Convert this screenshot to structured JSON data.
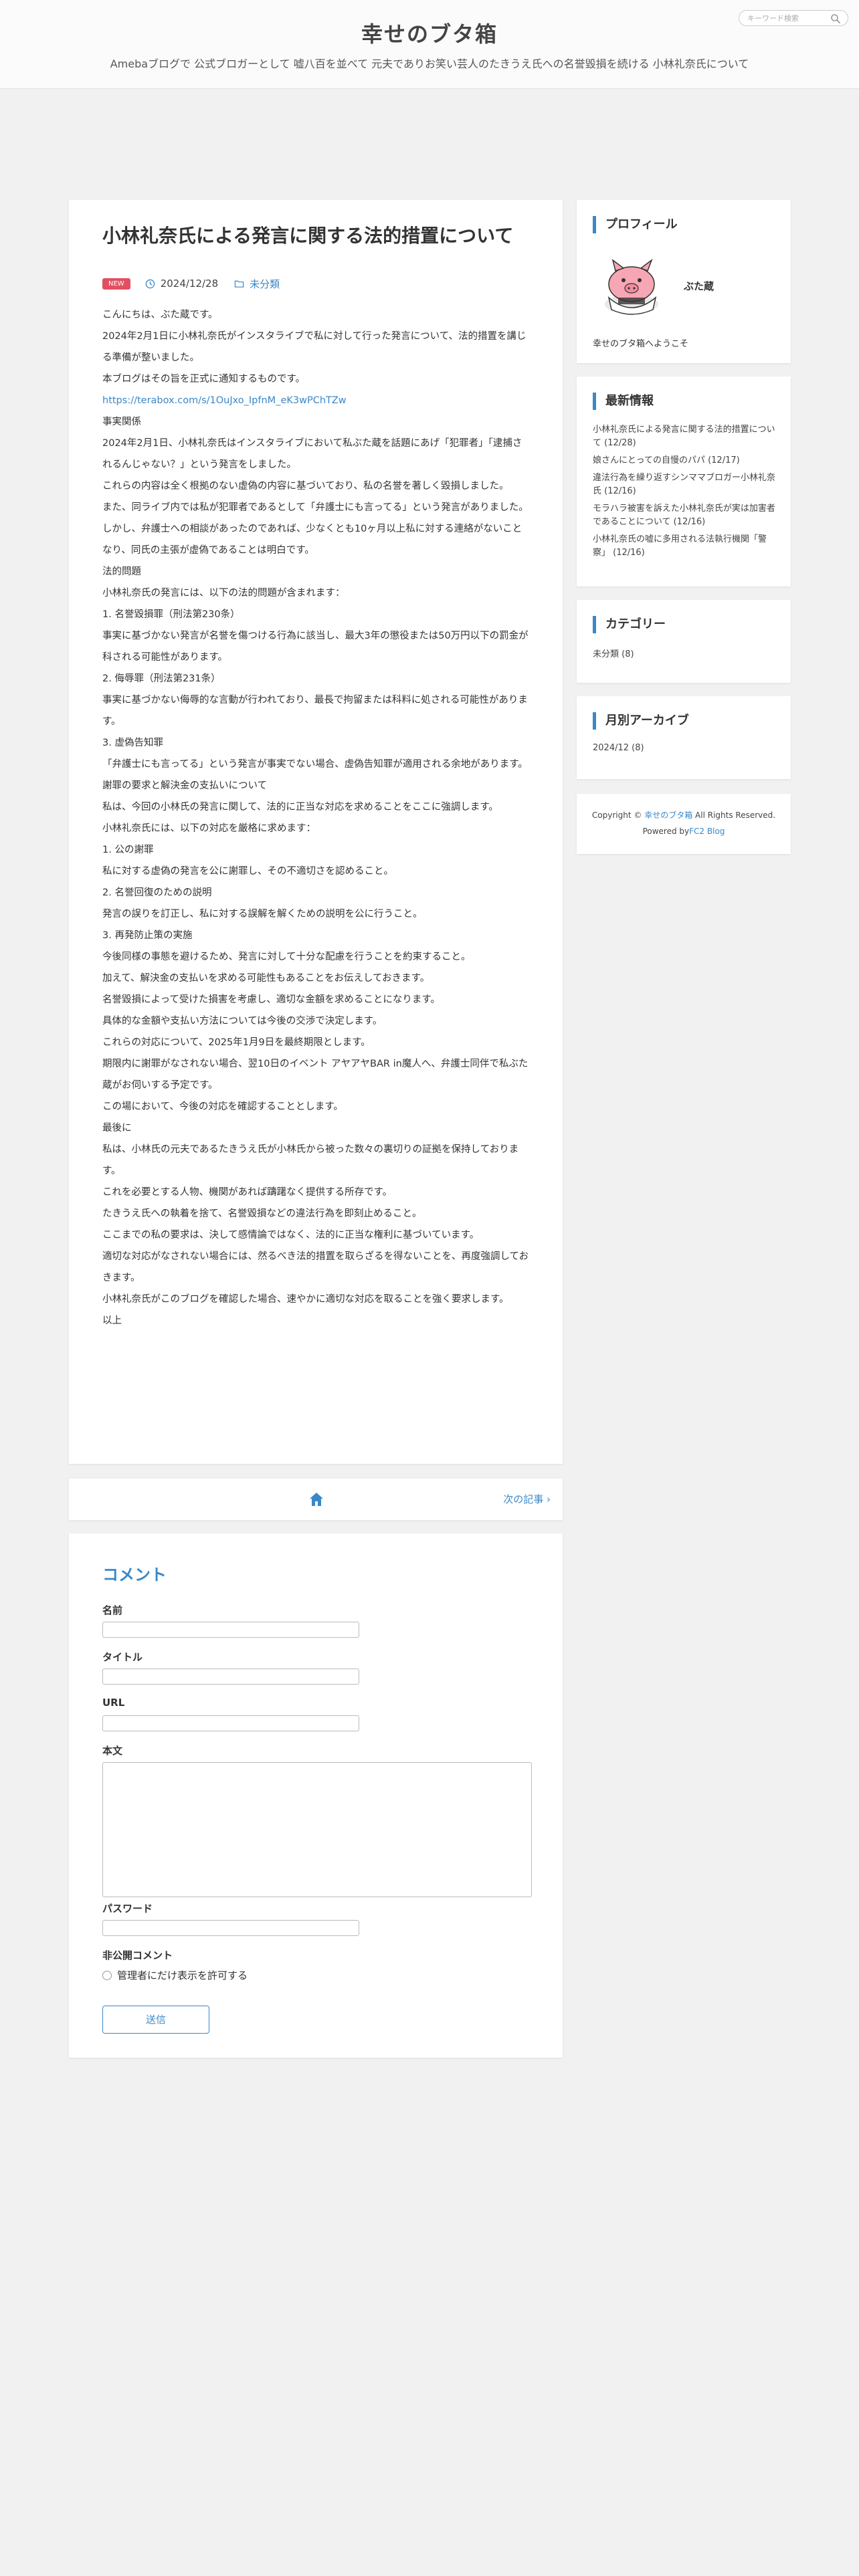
{
  "header": {
    "title": "幸せのブタ箱",
    "description": "Amebaブログで 公式ブロガーとして 嘘八百を並べて 元夫でありお笑い芸人のたきうえ氏への名誉毀損を続ける 小林礼奈氏について",
    "search_placeholder": "キーワード検索"
  },
  "post": {
    "title": "小林礼奈氏による発言に関する法的措置について",
    "badge": "NEW",
    "date": "2024/12/28",
    "category": "未分類",
    "paragraphs": [
      "こんにちは、ぶた蔵です。",
      "2024年2月1日に小林礼奈氏がインスタライブで私に対して行った発言について、法的措置を講じる準備が整いました。",
      "本ブログはその旨を正式に通知するものです。",
      "https://terabox.com/s/1OuJxo_IpfnM_eK3wPChTZw",
      "事実関係",
      "2024年2月1日、小林礼奈氏はインスタライブにおいて私ぶた蔵を話題にあげ「犯罪者」「逮捕されるんじゃない？」という発言をしました。",
      "これらの内容は全く根拠のない虚偽の内容に基づいており、私の名誉を著しく毀損しました。",
      "また、同ライブ内では私が犯罪者であるとして「弁護士にも言ってる」という発言がありました。",
      "しかし、弁護士への相談があったのであれば、少なくとも10ヶ月以上私に対する連絡がないことなり、同氏の主張が虚偽であることは明白です。",
      "法的問題",
      "小林礼奈氏の発言には、以下の法的問題が含まれます：",
      "1. 名誉毀損罪（刑法第230条）",
      "事実に基づかない発言が名誉を傷つける行為に該当し、最大3年の懲役または50万円以下の罰金が科される可能性があります。",
      "2. 侮辱罪（刑法第231条）",
      "事実に基づかない侮辱的な言動が行われており、最長で拘留または科料に処される可能性があります。",
      "3. 虚偽告知罪",
      "「弁護士にも言ってる」という発言が事実でない場合、虚偽告知罪が適用される余地があります。",
      "謝罪の要求と解決金の支払いについて",
      "私は、今回の小林氏の発言に関して、法的に正当な対応を求めることをここに強調します。",
      "小林礼奈氏には、以下の対応を厳格に求めます：",
      "1. 公の謝罪",
      "私に対する虚偽の発言を公に謝罪し、その不適切さを認めること。",
      "2. 名誉回復のための説明",
      "発言の誤りを訂正し、私に対する誤解を解くための説明を公に行うこと。",
      "3. 再発防止策の実施",
      "今後同様の事態を避けるため、発言に対して十分な配慮を行うことを約束すること。",
      "加えて、解決金の支払いを求める可能性もあることをお伝えしておきます。",
      "名誉毀損によって受けた損害を考慮し、適切な金額を求めることになります。",
      "具体的な金額や支払い方法については今後の交渉で決定します。",
      "これらの対応について、2025年1月9日を最終期限とします。",
      "期限内に謝罪がなされない場合、翌10日のイベント アヤアヤBAR in魔人へ、弁護士同伴で私ぶた蔵がお伺いする予定です。",
      "この場において、今後の対応を確認することとします。",
      "最後に",
      "私は、小林氏の元夫であるたきうえ氏が小林氏から被った数々の裏切りの証拠を保持しております。",
      "これを必要とする人物、機関があれば躊躇なく提供する所存です。",
      "たきうえ氏への執着を捨て、名誉毀損などの違法行為を即刻止めること。",
      "ここまでの私の要求は、決して感情論ではなく、法的に正当な権利に基づいています。",
      "適切な対応がなされない場合には、然るべき法的措置を取らざるを得ないことを、再度強調しておきます。",
      "小林礼奈氏がこのブログを確認した場合、速やかに適切な対応を取ることを強く要求します。",
      "以上"
    ]
  },
  "nav": {
    "next_label": "次の記事"
  },
  "comment": {
    "heading": "コメント",
    "name_label": "名前",
    "title_label": "タイトル",
    "url_label": "URL",
    "body_label": "本文",
    "password_label": "パスワード",
    "private_label": "非公開コメント",
    "private_option": "管理者にだけ表示を許可する",
    "submit_label": "送信"
  },
  "sidebar": {
    "profile": {
      "heading": "プロフィール",
      "name": "ぶた蔵",
      "intro": "幸せのブタ箱へようこそ"
    },
    "recent": {
      "heading": "最新情報",
      "items": [
        "小林礼奈氏による発言に関する法的措置について (12/28)",
        "娘さんにとっての自慢のパパ (12/17)",
        "違法行為を繰り返すシンママブロガー小林礼奈氏 (12/16)",
        "モラハラ被害を訴えた小林礼奈氏が実は加害者であることについて (12/16)",
        "小林礼奈氏の嘘に多用される法執行機関「警察」 (12/16)"
      ]
    },
    "category": {
      "heading": "カテゴリー",
      "item": "未分類 (8)"
    },
    "archive": {
      "heading": "月別アーカイブ",
      "item": "2024/12 (8)"
    },
    "footer": {
      "copyright_prefix": "Copyright ©",
      "site_link": "幸せのブタ箱",
      "rights": "All Rights Reserved.",
      "powered_prefix": "Powered by",
      "powered_link": "FC2 Blog"
    }
  },
  "colors": {
    "accent": "#3a88c8",
    "badge": "#e15061",
    "background": "#f1f1f1"
  }
}
